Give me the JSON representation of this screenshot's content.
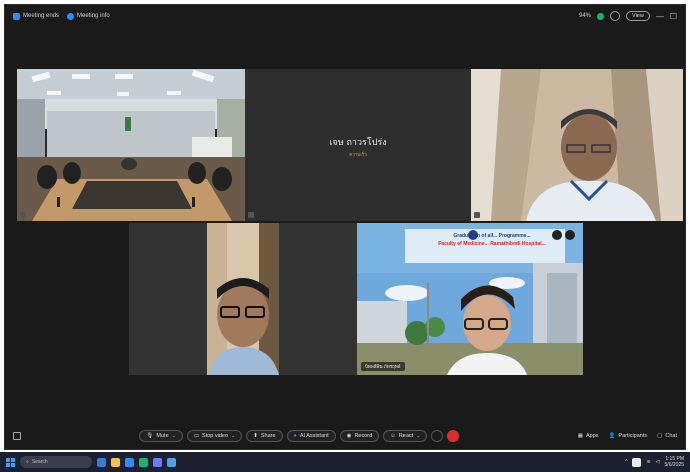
{
  "titlebar": {
    "items": [
      "Meeting ends",
      "Meeting info"
    ],
    "signal": "94%",
    "view_label": "View",
    "window_controls": [
      "—",
      "☐"
    ]
  },
  "tiles": {
    "center_name": "เจษ ถาวรโปร่ง",
    "center_sub": "ความเร็ว",
    "presenter_chip": "บิดพลีพิน ภัทรฤทธ์",
    "banner_line1": "Graduation of all... Programme...",
    "banner_line2": "Faculty of Medicine... Ramathibodi Hospital..."
  },
  "toolbar": {
    "mute": "Mute",
    "stop_video": "Stop video",
    "share": "Share",
    "ai_assistant": "AI Assistant",
    "record": "Record",
    "react": "React",
    "apps": "Apps",
    "participants": "Participants",
    "chat": "Chat"
  },
  "taskbar": {
    "search": "Search",
    "time": "1:15 PM",
    "date": "5/6/2025"
  },
  "colors": {
    "accent": "#2d8cff",
    "end": "#d92d2d",
    "window_bg": "#1a1a1a"
  }
}
